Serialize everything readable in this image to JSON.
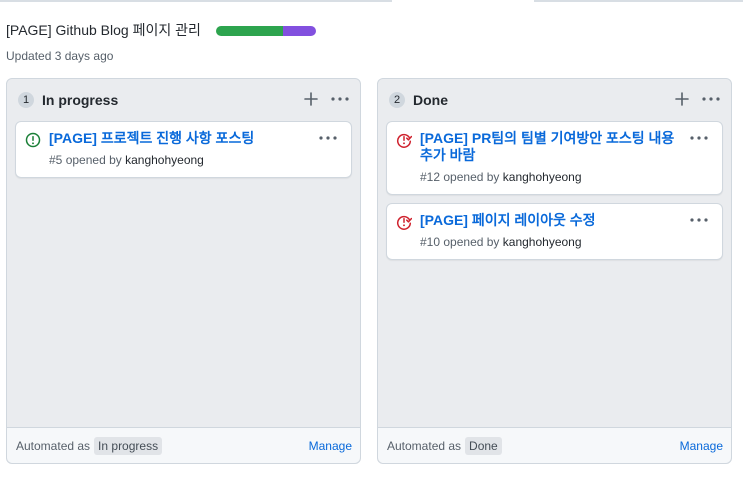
{
  "project": {
    "title": "[PAGE] Github Blog 페이지 관리",
    "updated": "Updated 3 days ago",
    "progress": {
      "done_fraction": 0.67,
      "in_progress_fraction": 0.33,
      "colors": {
        "done": "#2da44e",
        "in_progress": "#8250df"
      }
    }
  },
  "columns": [
    {
      "count": "1",
      "name": "In progress",
      "add_icon": "plus-icon",
      "more_icon": "kebab-horizontal-icon",
      "cards": [
        {
          "status_icon": "issue-opened-icon",
          "status_color": "#1a7f37",
          "title": "[PAGE] 프로젝트 진행 사항 포스팅",
          "number": "#5",
          "opened_by": "opened by",
          "author": "kanghohyeong"
        }
      ],
      "footer": {
        "automated_label": "Automated as",
        "automated_value": "In progress",
        "manage_label": "Manage"
      }
    },
    {
      "count": "2",
      "name": "Done",
      "add_icon": "plus-icon",
      "more_icon": "kebab-horizontal-icon",
      "cards": [
        {
          "status_icon": "issue-closed-icon",
          "status_color": "#cf222e",
          "title": "[PAGE] PR팀의 팀별 기여방안 포스팅 내용 추가 바람",
          "number": "#12",
          "opened_by": "opened by",
          "author": "kanghohyeong"
        },
        {
          "status_icon": "issue-closed-icon",
          "status_color": "#cf222e",
          "title": "[PAGE] 페이지 레이아웃 수정",
          "number": "#10",
          "opened_by": "opened by",
          "author": "kanghohyeong"
        }
      ],
      "footer": {
        "automated_label": "Automated as",
        "automated_value": "Done",
        "manage_label": "Manage"
      }
    }
  ],
  "colors": {
    "link": "#0969da",
    "column_bg": "#eaecef",
    "border": "#d0d7de"
  }
}
